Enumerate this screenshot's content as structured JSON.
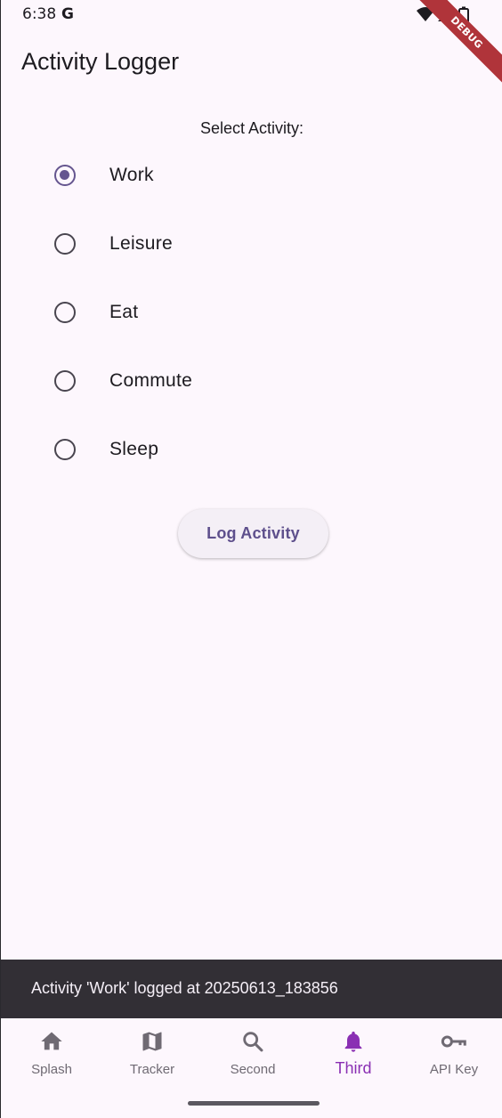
{
  "status_bar": {
    "time": "6:38",
    "g_icon": "G",
    "icons": [
      "wifi-icon",
      "signal-icon",
      "battery-icon"
    ],
    "debug_banner": "DEBUG"
  },
  "app_bar": {
    "title": "Activity Logger"
  },
  "form": {
    "label": "Select Activity:",
    "selected": "Work",
    "options": [
      {
        "label": "Work",
        "selected": true
      },
      {
        "label": "Leisure",
        "selected": false
      },
      {
        "label": "Eat",
        "selected": false
      },
      {
        "label": "Commute",
        "selected": false
      },
      {
        "label": "Sleep",
        "selected": false
      }
    ],
    "button_label": "Log Activity"
  },
  "snackbar": {
    "message": "Activity 'Work' logged at 20250613_183856"
  },
  "bottom_nav": {
    "active": "Third",
    "items": [
      {
        "label": "Splash",
        "icon": "home-icon"
      },
      {
        "label": "Tracker",
        "icon": "map-icon"
      },
      {
        "label": "Second",
        "icon": "search-icon"
      },
      {
        "label": "Third",
        "icon": "bell-icon"
      },
      {
        "label": "API Key",
        "icon": "key-icon"
      }
    ]
  },
  "colors": {
    "background": "#fdf7fd",
    "accent": "#65558f",
    "nav_active": "#8a2fb3",
    "snackbar": "#322f35"
  }
}
